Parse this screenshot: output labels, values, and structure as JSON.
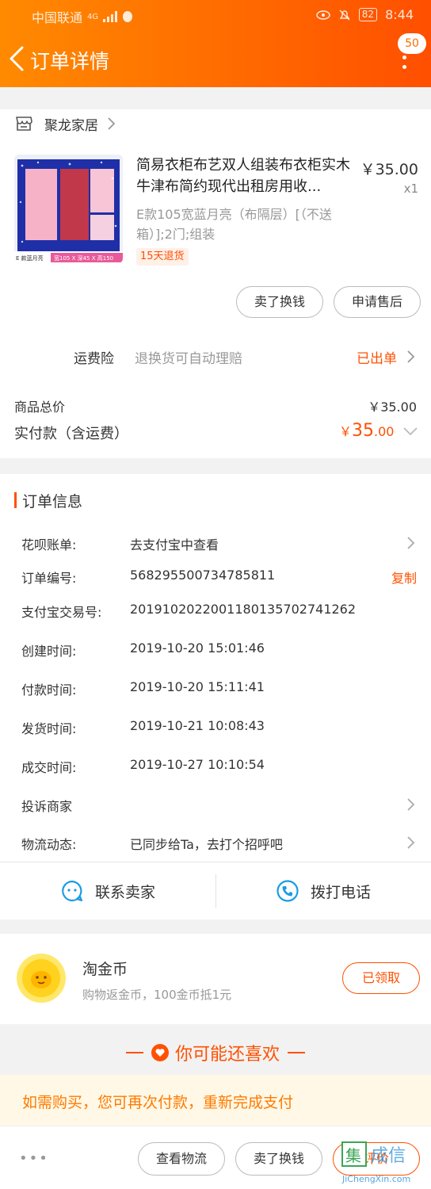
{
  "status_bar": {
    "carrier": "中国联通",
    "signal": "4G",
    "battery": "82",
    "time": "8:44"
  },
  "header": {
    "title": "订单详情",
    "badge_count": "50",
    "back_icon": "chevron-left-icon",
    "more_icon": "more-vertical-icon"
  },
  "shop": {
    "name": "聚龙家居",
    "icon": "shop-icon"
  },
  "product": {
    "title": "简易衣柜布艺双人组装布衣柜实木牛津布简约现代出租房用收...",
    "price": "￥35.00",
    "quantity": "x1",
    "sku": "E款105宽蓝月亮（布隔层）[（不送箱）];2门;组装",
    "return_tag": "15天退货",
    "image_caption": "E款105宽蓝月亮 · 宽105 X 深45 X 高150"
  },
  "actions": {
    "sell_exchange": "卖了换钱",
    "after_sale": "申请售后"
  },
  "insurance": {
    "label": "运费险",
    "description": "退换货可自动理赔",
    "status": "已出单"
  },
  "summary": {
    "total_label": "商品总价",
    "total_value": "￥35.00",
    "paid_label": "实付款（含运费）",
    "paid_currency": "￥",
    "paid_integer": "35",
    "paid_decimal": ".00"
  },
  "order_info": {
    "title": "订单信息",
    "rows": [
      {
        "label": "花呗账单:",
        "value": "去支付宝中查看"
      },
      {
        "label": "订单编号:",
        "value": "568295500734785811",
        "action": "复制"
      },
      {
        "label": "支付宝交易号:",
        "value": "2019102022001180135702741262"
      },
      {
        "label": "创建时间:",
        "value": "2019-10-20 15:01:46"
      },
      {
        "label": "付款时间:",
        "value": "2019-10-20 15:11:41"
      },
      {
        "label": "发货时间:",
        "value": "2019-10-21 10:08:43"
      },
      {
        "label": "成交时间:",
        "value": "2019-10-27 10:10:54"
      },
      {
        "label": "投诉商家",
        "value": ""
      },
      {
        "label": "物流动态:",
        "value": "已同步给Ta，去打个招呼吧"
      }
    ],
    "contact_seller": "联系卖家",
    "call_phone": "拨打电话"
  },
  "coins": {
    "title": "淘金币",
    "description": "购物返金币，100金币抵1元",
    "button": "已领取"
  },
  "recommend": {
    "title": "你可能还喜欢"
  },
  "repay": {
    "text": "如需购买，您可再次付款，重新完成支付"
  },
  "bottom_bar": {
    "more": "•••",
    "track": "查看物流",
    "sell": "卖了换钱",
    "rate": "评价"
  },
  "watermark": {
    "text": "JiChengXin.com"
  },
  "colors": {
    "accent": "#ff5000",
    "header_start": "#ff8a00",
    "header_end": "#ff4f00",
    "contact_icon": "#1a9be8"
  }
}
